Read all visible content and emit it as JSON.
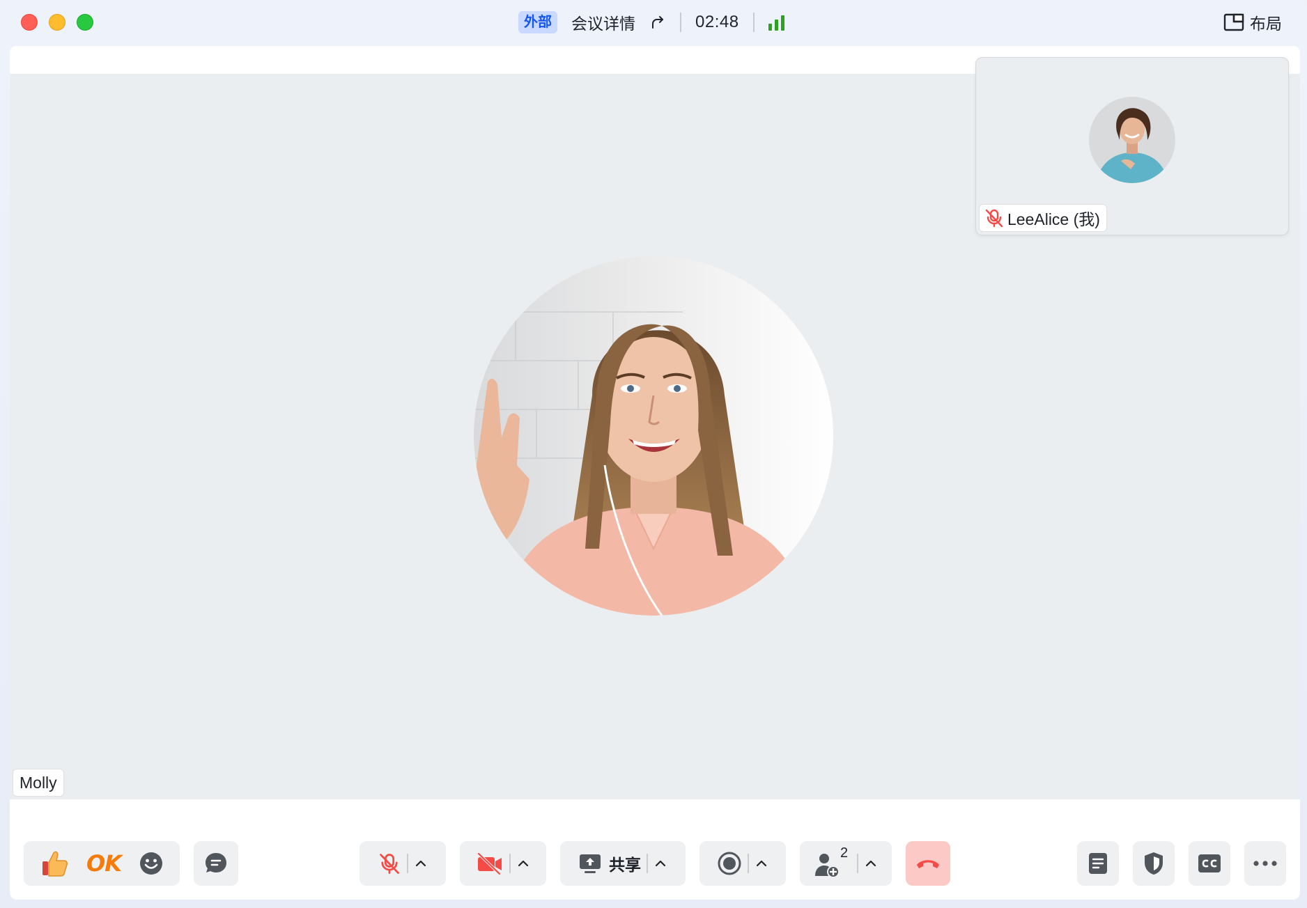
{
  "titlebar": {
    "tag": "外部",
    "meeting_detail": "会议详情",
    "timer": "02:48",
    "layout_label": "布局"
  },
  "main_participant": {
    "name": "Molly"
  },
  "self_tile": {
    "name": "LeeAlice (我)",
    "muted": true
  },
  "toolbar": {
    "share_label": "共享",
    "participant_count": "2",
    "ok_label": "OK"
  },
  "colors": {
    "accent": "#1456f0",
    "signal": "#2ea121",
    "muted_red": "#f54a45",
    "hangup_bg": "#fcc9c6",
    "hangup_icon": "#f54a45"
  }
}
